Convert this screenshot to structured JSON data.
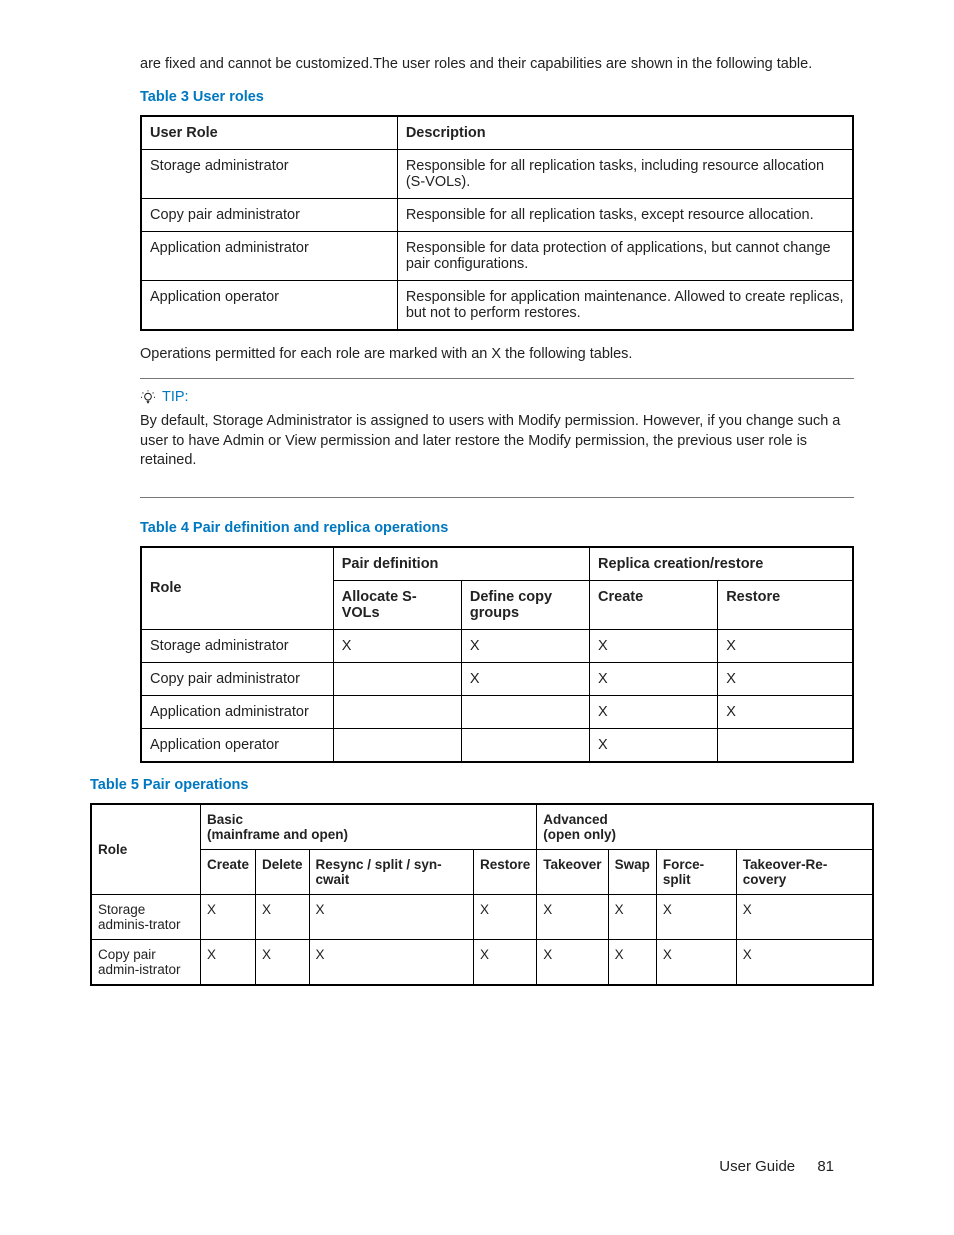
{
  "intro_para": "are fixed and cannot be customized.The user roles and their capabilities are shown in the following table.",
  "table3": {
    "caption": "Table 3 User roles",
    "headers": [
      "User Role",
      "Description"
    ],
    "rows": [
      [
        "Storage administrator",
        "Responsible for all replication tasks, including resource allocation (S-VOLs)."
      ],
      [
        "Copy pair administrator",
        "Responsible for all replication tasks, except resource allocation."
      ],
      [
        "Application administrator",
        "Responsible for data protection of applications, but cannot change pair configurations."
      ],
      [
        "Application operator",
        "Responsible for application maintenance. Allowed to create replicas, but not to perform restores."
      ]
    ]
  },
  "mid_para": "Operations permitted for each role are marked with an X the following tables.",
  "tip": {
    "label": "TIP:",
    "body": "By default, Storage Administrator is assigned to users with Modify permission. However, if you change such a user to have Admin or View permission and later restore the Modify permission, the previous user role is retained."
  },
  "table4": {
    "caption": "Table 4 Pair definition and replica operations",
    "role_header": "Role",
    "group_headers": [
      "Pair definition",
      "Replica creation/restore"
    ],
    "sub_headers": [
      "Allocate S-VOLs",
      "Define copy groups",
      "Create",
      "Restore"
    ],
    "rows": [
      [
        "Storage administrator",
        "X",
        "X",
        "X",
        "X"
      ],
      [
        "Copy pair administrator",
        "",
        "X",
        "X",
        "X"
      ],
      [
        "Application administrator",
        "",
        "",
        "X",
        "X"
      ],
      [
        "Application operator",
        "",
        "",
        "X",
        ""
      ]
    ]
  },
  "table5": {
    "caption": "Table 5 Pair operations",
    "role_header": "Role",
    "group_headers": [
      "Basic\n(mainframe and open)",
      "Advanced\n(open only)"
    ],
    "sub_headers": [
      "Create",
      "Delete",
      "Resync / split / syn-cwait",
      "Restore",
      "Takeover",
      "Swap",
      "Force-split",
      "Takeover-Re-covery"
    ],
    "rows": [
      [
        "Storage adminis-trator",
        "X",
        "X",
        "X",
        "X",
        "X",
        "X",
        "X",
        "X"
      ],
      [
        "Copy pair admin-istrator",
        "X",
        "X",
        "X",
        "X",
        "X",
        "X",
        "X",
        "X"
      ]
    ]
  },
  "footer": {
    "doc": "User Guide",
    "page": "81"
  }
}
